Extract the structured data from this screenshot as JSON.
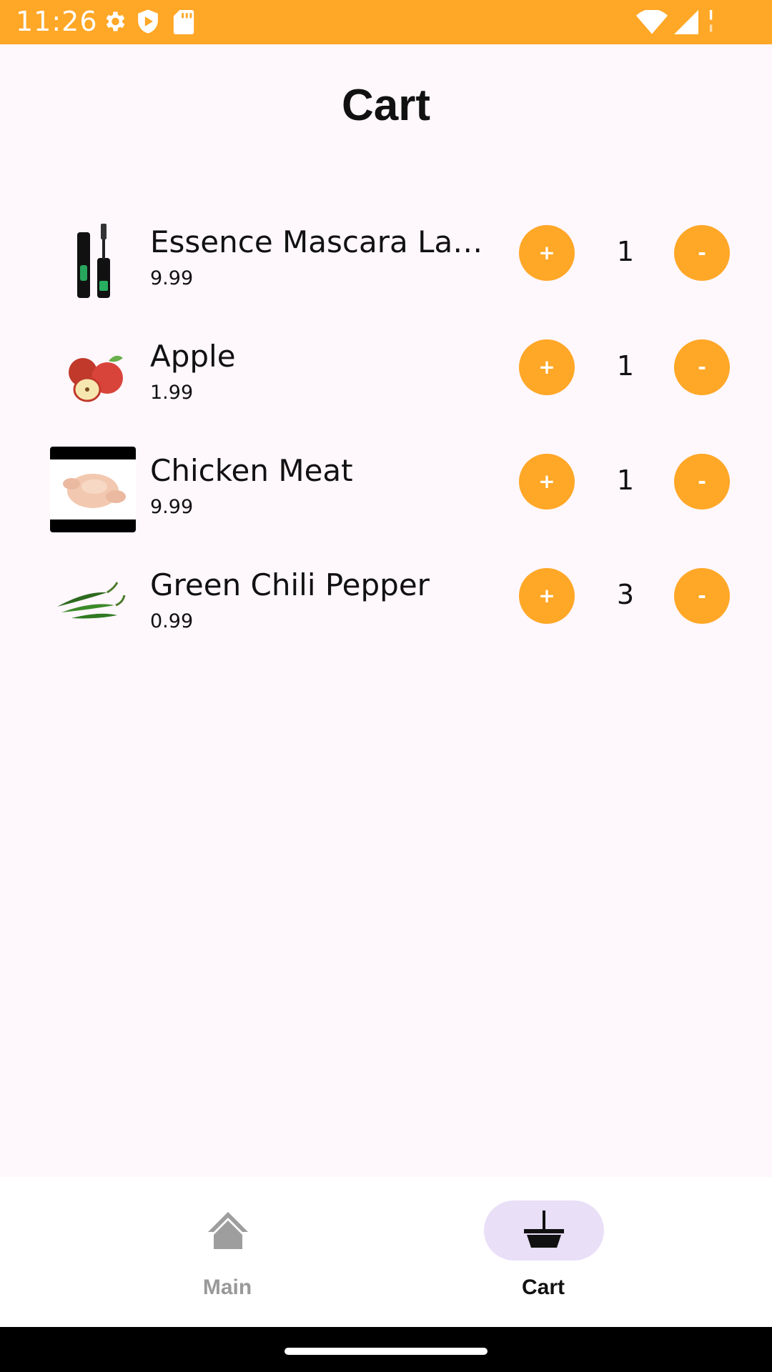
{
  "status_bar": {
    "time": "11:26",
    "background": "#FFA726",
    "icons": [
      "gear-icon",
      "shield-play-icon",
      "sd-card-icon",
      "wifi-icon",
      "signal-icon",
      "battery-icon"
    ]
  },
  "page": {
    "title": "Cart"
  },
  "cart": {
    "accent_color": "#FFA726",
    "plus_label": "+",
    "minus_label": "-",
    "items": [
      {
        "name": "Essence Mascara Lash Princess",
        "price": "9.99",
        "quantity": "1",
        "image_icon": "mascara-image"
      },
      {
        "name": "Apple",
        "price": "1.99",
        "quantity": "1",
        "image_icon": "apple-image"
      },
      {
        "name": "Chicken Meat",
        "price": "9.99",
        "quantity": "1",
        "image_icon": "chicken-image"
      },
      {
        "name": "Green Chili Pepper",
        "price": "0.99",
        "quantity": "3",
        "image_icon": "chili-pepper-image"
      }
    ]
  },
  "bottom_nav": {
    "items": [
      {
        "label": "Main",
        "icon": "home-icon",
        "selected": false
      },
      {
        "label": "Cart",
        "icon": "basket-icon",
        "selected": true
      }
    ],
    "selected_pill_color": "#E9DFF7"
  }
}
